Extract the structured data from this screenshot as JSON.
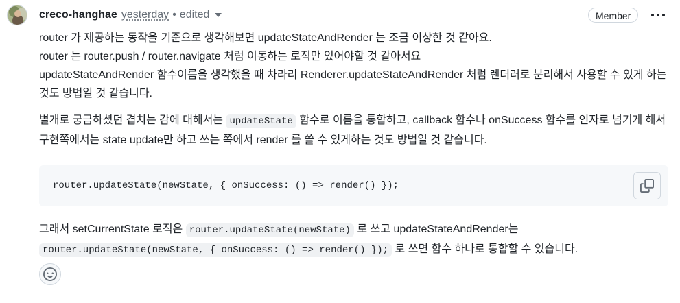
{
  "comment": {
    "author": "creco-hanghae",
    "timestamp": "yesterday",
    "separator": "•",
    "edited_label": "edited",
    "role_badge": "Member",
    "paragraph1": [
      "router 가 제공하는 동작을 기준으로 생각해보면 updateStateAndRender 는 조금 이상한 것 같아요.",
      "router 는 router.push / router.navigate 처럼 이동하는 로직만 있어야할 것 같아서요",
      "updateStateAndRender 함수이름을 생각했을 때 차라리 Renderer.updateStateAndRender 처럼 렌더러로 분리해서 사용할 수 있게 하는 것도 방법일 것 같습니다."
    ],
    "paragraph2": {
      "before": "별개로 궁금하셨던 겹치는 감에 대해서는 ",
      "code": "updateState",
      "after": " 함수로 이름을 통합하고, callback 함수나 onSuccess 함수를 인자로 넘기게 해서 구현쪽에서는 state update만 하고 쓰는 쪽에서 render 를 쓸 수 있게하는 것도 방법일 것 같습니다."
    },
    "code_block": "router.updateState(newState, { onSuccess: () => render() });",
    "paragraph3": {
      "t1": "그래서 setCurrentState 로직은 ",
      "code1": "router.updateState(newState)",
      "t2": " 로 쓰고 updateStateAndRender는",
      "code2": "router.updateState(newState, { onSuccess: () => render() });",
      "t3": " 로 쓰면 함수 하나로 통합할 수 있습니다."
    }
  },
  "icons": {
    "avatar": "avatar-image",
    "menu": "kebab-horizontal-icon",
    "copy": "copy-icon",
    "reaction": "smiley-icon",
    "dropdown": "triangle-down-icon"
  },
  "colors": {
    "text": "#1f2328",
    "muted": "#656d76",
    "border": "#d0d7de",
    "code_bg": "#f6f8fa",
    "inline_code_bg": "#eff1f3"
  }
}
